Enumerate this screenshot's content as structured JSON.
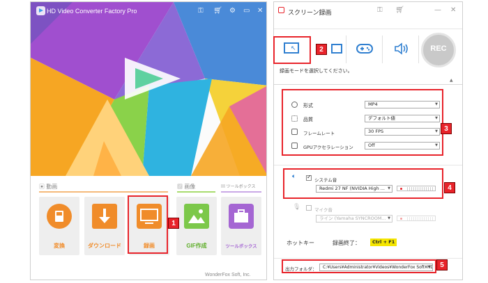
{
  "left_window": {
    "title": "HD Video Converter Factory Pro",
    "sections": {
      "video": "動画",
      "image": "画像",
      "toolbox": "ツールボックス"
    },
    "tiles": [
      {
        "id": "convert",
        "label": "変換"
      },
      {
        "id": "download",
        "label": "ダウンロード"
      },
      {
        "id": "record",
        "label": "録画"
      },
      {
        "id": "gif",
        "label": "GIF作成"
      },
      {
        "id": "toolbox",
        "label": "ツールボックス"
      }
    ],
    "footer": "WonderFox Soft, Inc."
  },
  "right_window": {
    "title": "スクリーン録画",
    "rec_label": "REC",
    "hint": "録画モードを選択してください。",
    "settings": {
      "format_label": "形式",
      "format_value": "MP4",
      "quality_label": "品質",
      "quality_value": "デフォルト値",
      "framerate_label": "フレームレート",
      "framerate_value": "30 FPS",
      "gpu_label": "GPUアクセラレーション",
      "gpu_value": "Off"
    },
    "audio": {
      "system_label": "システム音",
      "system_device": "Redmi 27 NF (NVIDIA High ...",
      "mic_label": "マイク音",
      "mic_device": "ライン (Yamaha SYNCROOM..."
    },
    "hotkey_label": "ホットキー",
    "record_end_label": "録画終了：",
    "record_end_key": "Ctrl + F1",
    "output_label": "出力フォルダ：",
    "output_path": "C:¥Users¥Administrator¥Videos¥WonderFox Soft¥HD V"
  },
  "badges": [
    "1",
    "2",
    "3",
    "4",
    "5"
  ],
  "colors": {
    "annotation_red": "#e8232a",
    "accent_orange": "#f08c2a",
    "hotkey_yellow": "#f5e600"
  }
}
